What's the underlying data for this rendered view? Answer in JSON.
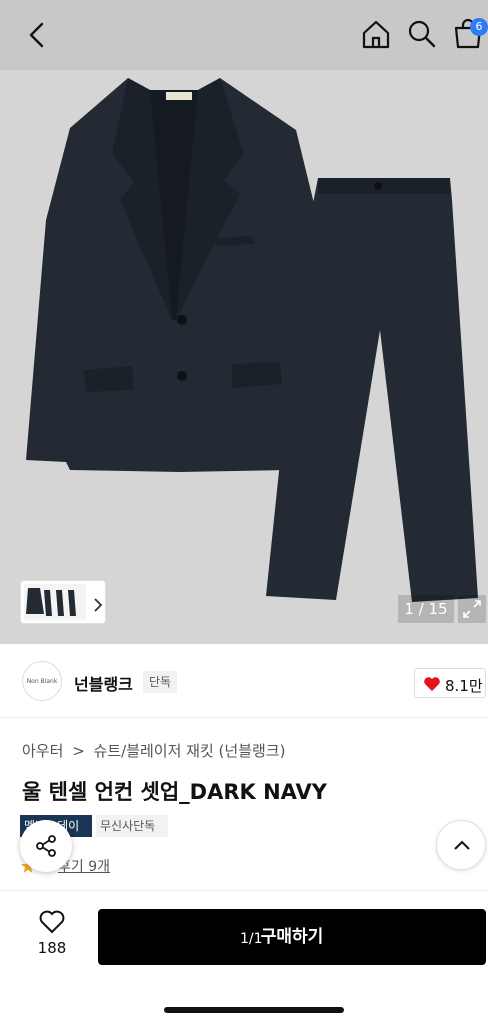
{
  "header": {
    "back_icon": "chevron-left-icon",
    "home_icon": "home-icon",
    "search_icon": "search-icon",
    "cart_icon": "cart-icon",
    "cart_badge": "6",
    "colors": {
      "bar": "#c8c8c8",
      "badge": "#2f7bf6"
    }
  },
  "gallery": {
    "counter": "1 / 15",
    "expand_icon": "expand-icon",
    "thumb_chevron_icon": "chevron-right-icon"
  },
  "brand": {
    "logo_text": "Non Blank",
    "name": "넌블랭크",
    "tag": "단독",
    "like_icon": "heart-icon",
    "like_count": "8.1만",
    "like_color": "#e3141c"
  },
  "product": {
    "breadcrumb": [
      "아우터",
      ">",
      "슈트/블레이저 재킷 (넌블랭크)"
    ],
    "title": "울 텐셀 언컨 셋업_DARK NAVY",
    "tags": [
      "멤버스데이",
      "무신사단독"
    ],
    "rating_score": "5",
    "reviews": "후기 9개",
    "tag_color": "#1a3556"
  },
  "fabs": {
    "share_icon": "share-icon",
    "scroll_top_icon": "chevron-up-icon"
  },
  "bottom": {
    "wish_icon": "heart-outline-icon",
    "wish_count": "188",
    "buy_label": "구매하기",
    "page_indicator": "1/1"
  }
}
